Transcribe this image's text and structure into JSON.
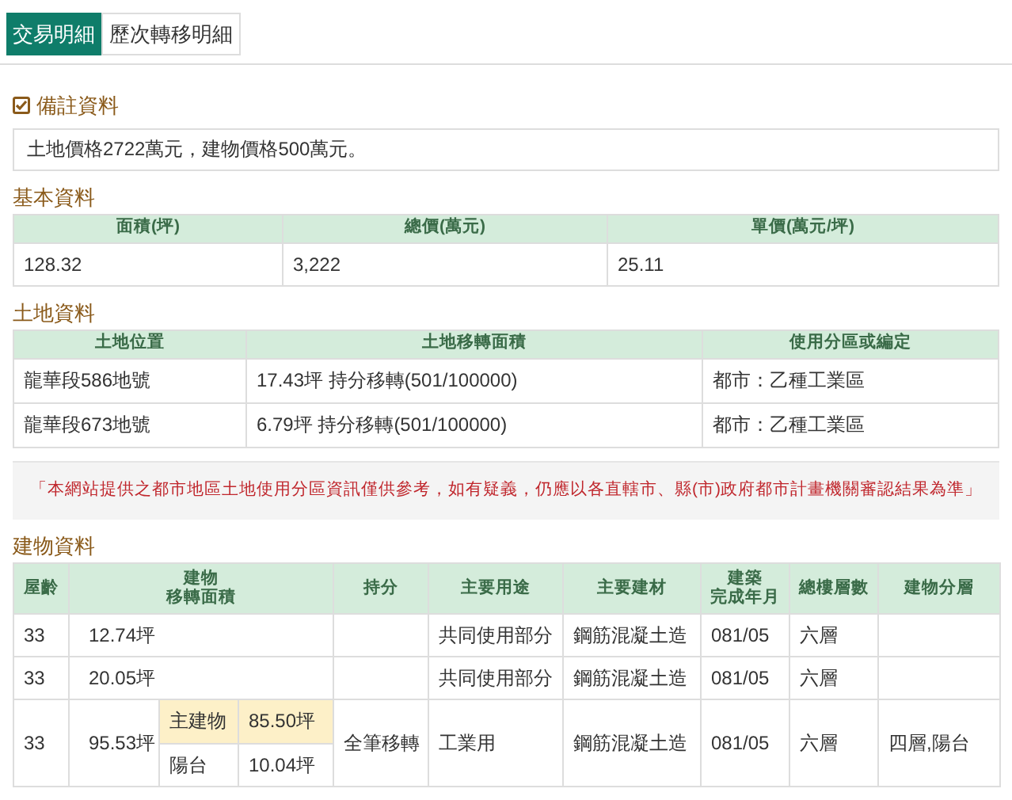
{
  "tabs": [
    {
      "label": "交易明細",
      "selected": true
    },
    {
      "label": "歷次轉移明細",
      "selected": false
    }
  ],
  "remarks": {
    "title": "備註資料",
    "checked": true,
    "text": "土地價格2722萬元，建物價格500萬元。"
  },
  "basic": {
    "title": "基本資料",
    "columns": [
      "面積(坪)",
      "總價(萬元)",
      "單價(萬元/坪)"
    ],
    "values": [
      "128.32",
      "3,222",
      "25.11"
    ]
  },
  "land": {
    "title": "土地資料",
    "columns": [
      "土地位置",
      "土地移轉面積",
      "使用分區或編定"
    ],
    "rows": [
      [
        "龍華段586地號",
        "17.43坪 持分移轉(501/100000)",
        "都市：乙種工業區"
      ],
      [
        "龍華段673地號",
        "6.79坪 持分移轉(501/100000)",
        "都市：乙種工業區"
      ]
    ]
  },
  "notice": "「本網站提供之都市地區土地使用分區資訊僅供參考，如有疑義，仍應以各直轄市、縣(市)政府都市計畫機關審認結果為準」",
  "building": {
    "title": "建物資料",
    "columns": [
      [
        "屋齡"
      ],
      [
        "建物",
        "移轉面積"
      ],
      [
        "持分"
      ],
      [
        "主要用途"
      ],
      [
        "主要建材"
      ],
      [
        "建築",
        "完成年月"
      ],
      [
        "總樓層數"
      ],
      [
        "建物分層"
      ]
    ],
    "rows": [
      {
        "age": "33",
        "area": "12.74坪",
        "share": "",
        "use": "共同使用部分",
        "material": "鋼筋混凝土造",
        "completed": "081/05",
        "floors": "六層",
        "layers": ""
      },
      {
        "age": "33",
        "area": "20.05坪",
        "share": "",
        "use": "共同使用部分",
        "material": "鋼筋混凝土造",
        "completed": "081/05",
        "floors": "六層",
        "layers": ""
      },
      {
        "age": "33",
        "area": "95.53坪",
        "share": "全筆移轉",
        "use": "工業用",
        "material": "鋼筋混凝土造",
        "completed": "081/05",
        "floors": "六層",
        "layers": "四層,陽台",
        "parts": [
          {
            "name": "主建物",
            "area": "85.50坪",
            "highlighted": true
          },
          {
            "name": "陽台",
            "area": "10.04坪",
            "highlighted": false
          }
        ]
      }
    ]
  }
}
